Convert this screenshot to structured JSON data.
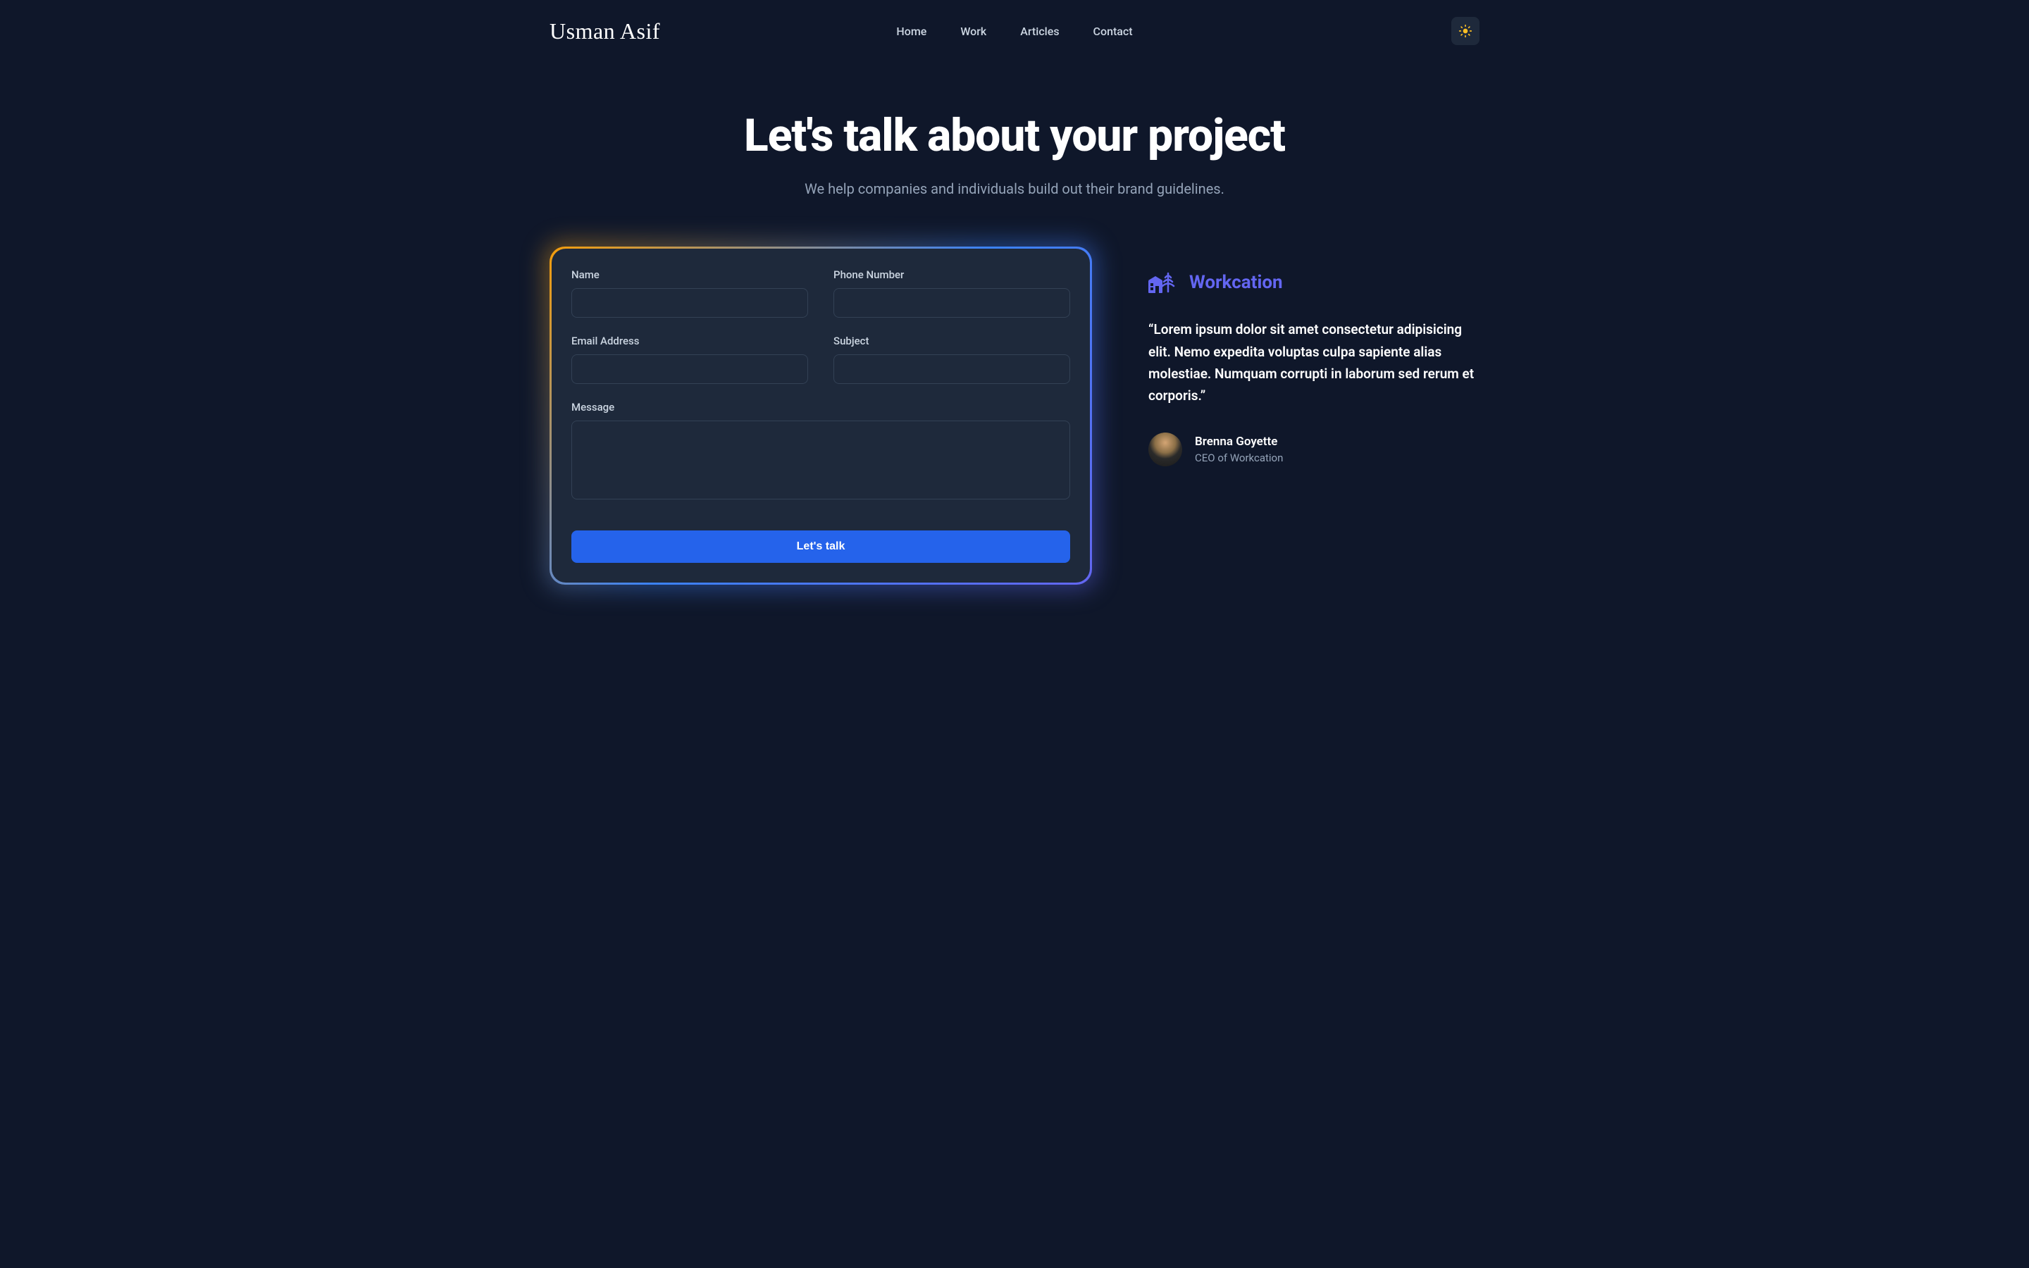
{
  "logo": "Usman Asif",
  "nav": {
    "home": "Home",
    "work": "Work",
    "articles": "Articles",
    "contact": "Contact"
  },
  "hero": {
    "title": "Let's talk about your project",
    "subtitle": "We help companies and individuals build out their brand guidelines."
  },
  "form": {
    "labels": {
      "name": "Name",
      "phone": "Phone Number",
      "email": "Email Address",
      "subject": "Subject",
      "message": "Message"
    },
    "submit": "Let's talk"
  },
  "testimonial": {
    "brand": "Workcation",
    "quote": "“Lorem ipsum dolor sit amet consectetur adipisicing elit. Nemo expedita voluptas culpa sapiente alias molestiae. Numquam corrupti in laborum sed rerum et corporis.”",
    "author_name": "Brenna Goyette",
    "author_title": "CEO of Workcation"
  }
}
